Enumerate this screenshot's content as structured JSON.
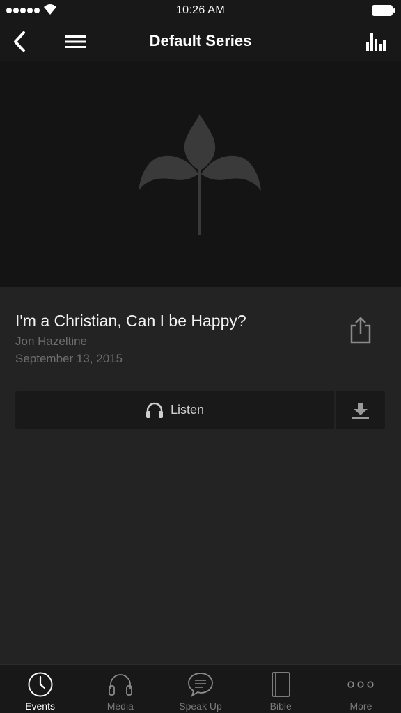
{
  "status_bar": {
    "time": "10:26 AM"
  },
  "nav": {
    "title": "Default Series"
  },
  "sermon": {
    "title": "I'm a Christian, Can I be Happy?",
    "speaker": "Jon Hazeltine",
    "date": "September 13, 2015"
  },
  "actions": {
    "listen_label": "Listen"
  },
  "tabs": [
    {
      "label": "Events",
      "icon": "clock-icon",
      "active": true
    },
    {
      "label": "Media",
      "icon": "headphones-icon",
      "active": false
    },
    {
      "label": "Speak Up",
      "icon": "speech-bubble-icon",
      "active": false
    },
    {
      "label": "Bible",
      "icon": "book-icon",
      "active": false
    },
    {
      "label": "More",
      "icon": "ellipsis-icon",
      "active": false
    }
  ],
  "colors": {
    "background": "#232323",
    "bars": "#181818",
    "hero": "#141414",
    "muted_text": "#6e6e6e",
    "icon_gray": "#8a8a8a"
  }
}
